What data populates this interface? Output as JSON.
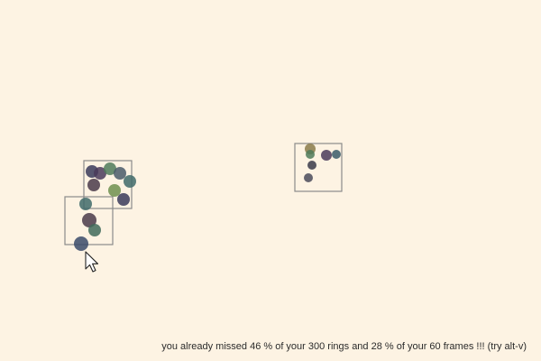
{
  "status": {
    "message": "you already missed 46 % of your 300 rings and 28 % of your 60 frames !!! (try alt-v)"
  },
  "colors": {
    "background": "#fdf3e3",
    "frame_border": "#8a8a8a",
    "ring_colors": [
      "#3a3a5a",
      "#4f6a4f",
      "#3f6a6a",
      "#5a4a5a",
      "#6f8f4f",
      "#4a5a7a",
      "#8a7a4a"
    ]
  },
  "cursor": {
    "icon": "arrow-pointer-icon"
  }
}
